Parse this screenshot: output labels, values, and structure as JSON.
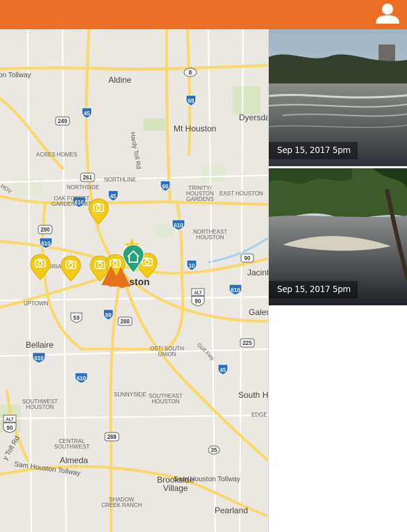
{
  "header": {
    "bg_color": "#ec6e25",
    "user_icon": "user-icon"
  },
  "map": {
    "labels": {
      "tollway": "on Tollway",
      "aldine": "Aldine",
      "mt_houston": "Mt Houston",
      "dyersdale": "Dyersda",
      "acres_homes": "ACRES HOMES",
      "northline": "NORTHLINE",
      "northside": "NORTHSIDE",
      "hov": "HOV",
      "oak_forest": "OAK FOREST\nGARDEN OAKS",
      "trinity": "TRINITY/\nHOUSTON\nGARDENS",
      "east_houston": "EAST HOUSTON",
      "northeast_houston": "NORTHEAST\nHOUSTON",
      "memorial": "MORIAL PARK",
      "houston": "ston",
      "jacinto": "Jacint",
      "uptown": "UPTOWN",
      "galena": "Galen",
      "bellaire": "Bellaire",
      "ost_south_union": "OST/ SOUTH\nUNION",
      "gulf_fwy": "Gulf Fwy",
      "sunnyside": "SUNNYSIDE",
      "southeast_houston": "SOUTHEAST\nHOUSTON",
      "south_houston": "South Ho",
      "southwest_houston": "SOUTHWEST\nHOUSTON",
      "edge": "EDGE",
      "central_southwest": "CENTRAL\nSOUTHWEST",
      "almeda": "Almeda",
      "sam_houston": "Sam Houston Tollway",
      "sam_houston_2": "Sam Houston Tollway",
      "tollrd": "y Toll Rd",
      "brookside": "Brookside\nVillage",
      "shadow_creek": "SHADOW\nCREEK RANCH",
      "pearland": "Pearland",
      "hardy": "Hardy Toll Rd"
    },
    "shields": {
      "i45_n": "45",
      "us8": "8",
      "i69_n": "69",
      "r249": "249",
      "r261": "261",
      "i45_mid": "45",
      "i69_mid": "69",
      "i610_n": "610",
      "i610_ne": "610",
      "r290": "290",
      "i610_w": "610",
      "i10": "10",
      "r90": "90",
      "alt90": "90",
      "i610_e": "610",
      "i59": "59",
      "i69_s": "69",
      "r288_a": "288",
      "i610_sw": "610",
      "r225": "225",
      "i45_s": "45",
      "i610_s": "610",
      "alt90_sw": "90",
      "r288_b": "288",
      "r35": "35"
    }
  },
  "photos": [
    {
      "timestamp": "Sep 15, 2017 5pm"
    },
    {
      "timestamp": "Sep 15, 2017 5pm"
    }
  ]
}
